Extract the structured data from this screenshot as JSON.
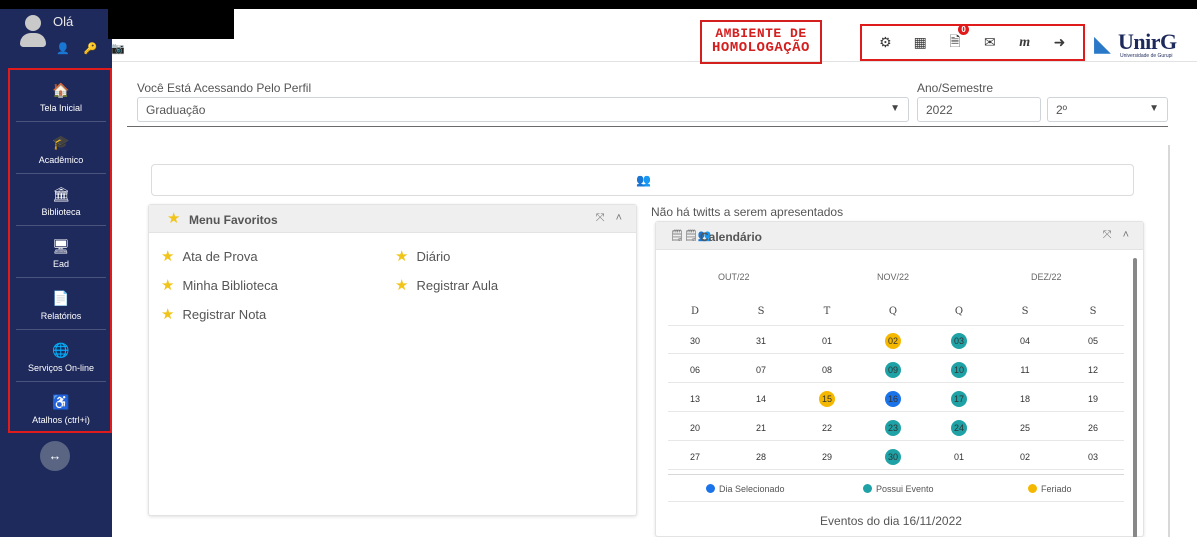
{
  "header": {
    "greeting": "Olá",
    "environment_line1": "AMBIENTE DE",
    "environment_line2": "HOMOLOGAÇÃO",
    "notifications_count": "0",
    "brand": "UnirG",
    "brand_sub": "Universidade de Gurupi",
    "icons": [
      "settings-icon",
      "apps-icon",
      "notifications-icon",
      "mail-icon",
      "moodle-icon",
      "logout-icon"
    ]
  },
  "sidebar": {
    "items": [
      {
        "label": "Tela Inicial",
        "icon": "home-icon",
        "glyph": "🏠"
      },
      {
        "label": "Acadêmico",
        "icon": "graduation-cap-icon",
        "glyph": "🎓"
      },
      {
        "label": "Biblioteca",
        "icon": "bank-icon",
        "glyph": "🏛"
      },
      {
        "label": "Ead",
        "icon": "screen-icon",
        "glyph": "🖥"
      },
      {
        "label": "Relatórios",
        "icon": "report-icon",
        "glyph": "📄"
      },
      {
        "label": "Serviços On-line",
        "icon": "globe-icon",
        "glyph": "🌐"
      },
      {
        "label": "Atalhos (ctrl+i)",
        "icon": "accessibility-icon",
        "glyph": "♿"
      }
    ],
    "toggle_glyph": "↔"
  },
  "profile": {
    "label": "Você Está Acessando Pelo Perfil",
    "value": "Graduação",
    "year_label": "Ano/Semestre",
    "year_value": "2022",
    "semester_value": "2º"
  },
  "favorites": {
    "title": "Menu Favoritos",
    "items": [
      "Ata de Prova",
      "Diário",
      "Minha Biblioteca",
      "Registrar Aula",
      "Registrar Nota"
    ]
  },
  "twitter": {
    "empty_text": "Não há twitts a serem apresentados"
  },
  "calendar": {
    "title": "Calendário",
    "months": [
      "OUT/22",
      "NOV/22",
      "DEZ/22"
    ],
    "weekdays": [
      "D",
      "S",
      "T",
      "Q",
      "Q",
      "S",
      "S"
    ],
    "weeks": [
      [
        "30",
        "31",
        "01",
        "02",
        "03",
        "04",
        "05"
      ],
      [
        "06",
        "07",
        "08",
        "09",
        "10",
        "11",
        "12"
      ],
      [
        "13",
        "14",
        "15",
        "16",
        "17",
        "18",
        "19"
      ],
      [
        "20",
        "21",
        "22",
        "23",
        "24",
        "25",
        "26"
      ],
      [
        "27",
        "28",
        "29",
        "30",
        "01",
        "02",
        "03"
      ]
    ],
    "marks": [
      [
        null,
        null,
        null,
        "holiday",
        "event",
        null,
        null
      ],
      [
        null,
        null,
        null,
        "event",
        "event",
        null,
        null
      ],
      [
        null,
        null,
        "holiday",
        "selected",
        "event",
        null,
        null
      ],
      [
        null,
        null,
        null,
        "event",
        "event",
        null,
        null
      ],
      [
        null,
        null,
        null,
        "event",
        null,
        null,
        null
      ]
    ],
    "colors": {
      "selected": "#1a73e8",
      "event": "#1fa2a6",
      "holiday": "#f5b800"
    },
    "legend": [
      "Dia Selecionado",
      "Possui Evento",
      "Feriado"
    ],
    "events_title": "Eventos do dia 16/11/2022"
  }
}
